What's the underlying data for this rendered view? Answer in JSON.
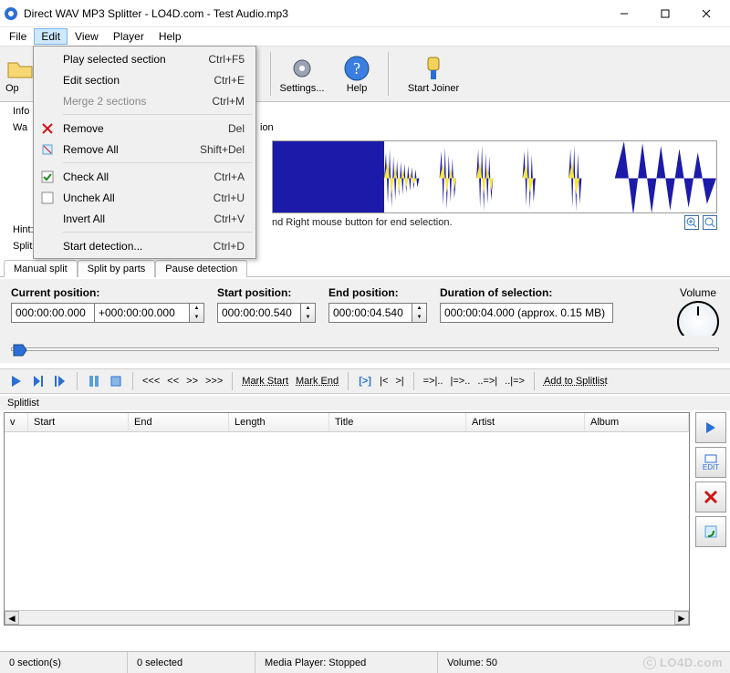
{
  "window": {
    "title": "Direct WAV MP3 Splitter - LO4D.com - Test Audio.mp3"
  },
  "menubar": [
    "File",
    "Edit",
    "View",
    "Player",
    "Help"
  ],
  "menubar_active_index": 1,
  "edit_menu": [
    {
      "type": "item",
      "icon": "",
      "label": "Play selected section",
      "shortcut": "Ctrl+F5"
    },
    {
      "type": "item",
      "icon": "",
      "label": "Edit section",
      "shortcut": "Ctrl+E"
    },
    {
      "type": "item",
      "icon": "",
      "label": "Merge 2 sections",
      "shortcut": "Ctrl+M",
      "disabled": true
    },
    {
      "type": "sep"
    },
    {
      "type": "item",
      "icon": "remove",
      "label": "Remove",
      "shortcut": "Del"
    },
    {
      "type": "item",
      "icon": "remove-all",
      "label": "Remove All",
      "shortcut": "Shift+Del"
    },
    {
      "type": "sep"
    },
    {
      "type": "item",
      "icon": "check",
      "label": "Check All",
      "shortcut": "Ctrl+A"
    },
    {
      "type": "item",
      "icon": "uncheck",
      "label": "Unchek All",
      "shortcut": "Ctrl+U"
    },
    {
      "type": "item",
      "icon": "",
      "label": "Invert All",
      "shortcut": "Ctrl+V"
    },
    {
      "type": "sep"
    },
    {
      "type": "item",
      "icon": "",
      "label": "Start detection...",
      "shortcut": "Ctrl+D"
    }
  ],
  "toolbar": {
    "open": "Op",
    "settings": "Settings...",
    "help": "Help",
    "joiner": "Start Joiner"
  },
  "behind": {
    "info": "Info",
    "wa": "Wa",
    "ion": "ion",
    "hint_label": "Hint:",
    "split_label": "Split"
  },
  "wave": {
    "cursor_time": "000:00:00.000",
    "hint_text": "nd Right mouse button for end selection."
  },
  "tabs": [
    "Manual split",
    "Split by parts",
    "Pause detection"
  ],
  "tabs_active_index": 0,
  "positions": {
    "current_label": "Current position:",
    "current_value": "000:00:00.000",
    "current_offset": "+000:00:00.000",
    "start_label": "Start position:",
    "start_value": "000:00:00.540",
    "end_label": "End position:",
    "end_value": "000:00:04.540",
    "duration_label": "Duration of selection:",
    "duration_value": "000:00:04.000  (approx. 0.15 MB)",
    "volume_label": "Volume"
  },
  "transport": {
    "mark_start": "Mark Start",
    "mark_end": "Mark End",
    "add": "Add to Splitlist"
  },
  "splitlist": {
    "caption": "Splitlist",
    "columns": [
      "v",
      "Start",
      "End",
      "Length",
      "Title",
      "Artist",
      "Album"
    ]
  },
  "sidebuttons": {
    "edit_label": "EDIT"
  },
  "status": {
    "sections": "0 section(s)",
    "selected": "0 selected",
    "player": "Media Player: Stopped",
    "volume": "Volume: 50"
  },
  "watermark": "LO4D.com"
}
